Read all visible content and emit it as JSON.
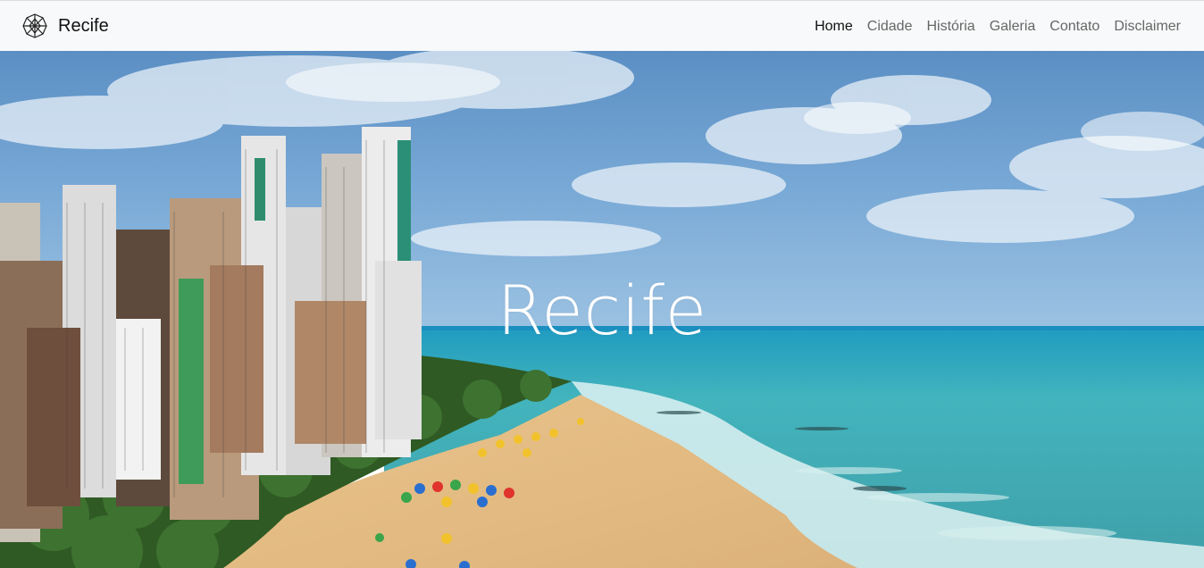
{
  "brand": {
    "name": "Recife",
    "logo_icon": "wheel-logo-icon"
  },
  "nav": {
    "items": [
      {
        "label": "Home",
        "active": true
      },
      {
        "label": "Cidade",
        "active": false
      },
      {
        "label": "História",
        "active": false
      },
      {
        "label": "Galeria",
        "active": false
      },
      {
        "label": "Contato",
        "active": false
      },
      {
        "label": "Disclaimer",
        "active": false
      }
    ]
  },
  "hero": {
    "title": "Recife",
    "image": "beach-city-skyline-photo"
  },
  "colors": {
    "navbar_bg": "#f8f9fa",
    "nav_active": "#111111",
    "nav_inactive": "#666666",
    "sky": "#6b9fcf",
    "sea": "#3aa9b6",
    "sand": "#e8c38a"
  }
}
